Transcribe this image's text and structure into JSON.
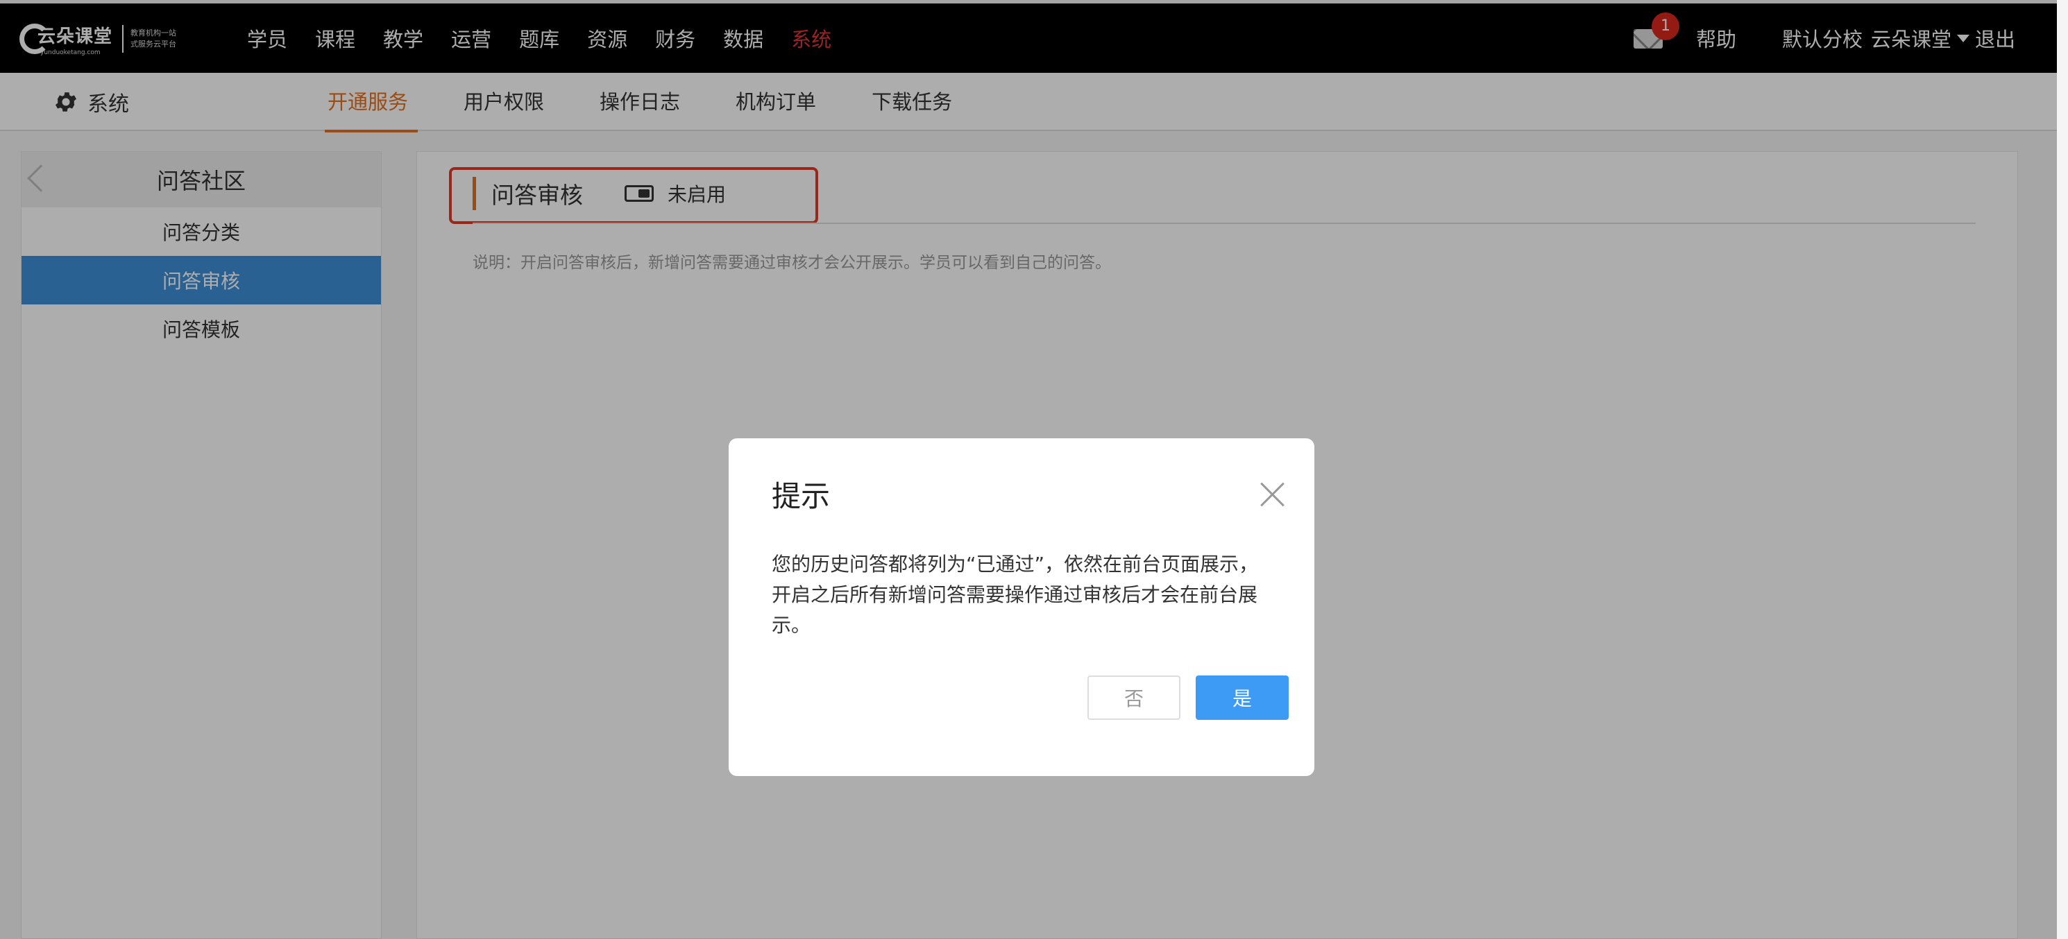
{
  "logo": {
    "name": "云朵课堂",
    "url": "yunduoketang.com",
    "slogan_line1": "教育机构一站",
    "slogan_line2": "式服务云平台"
  },
  "topnav": {
    "items": [
      "学员",
      "课程",
      "教学",
      "运营",
      "题库",
      "资源",
      "财务",
      "数据",
      "系统"
    ],
    "active": "系统"
  },
  "topright": {
    "mail_badge": "1",
    "help": "帮助",
    "school": "默认分校",
    "user": "云朵课堂",
    "logout": "退出"
  },
  "subbar": {
    "title": "系统",
    "tabs": [
      "开通服务",
      "用户权限",
      "操作日志",
      "机构订单",
      "下载任务"
    ],
    "active": "开通服务"
  },
  "sidebar": {
    "header": "问答社区",
    "items": [
      "问答分类",
      "问答审核",
      "问答模板"
    ],
    "active": "问答审核"
  },
  "main": {
    "section_title": "问答审核",
    "toggle_label": "未启用",
    "description": "说明：开启问答审核后，新增问答需要通过审核才会公开展示。学员可以看到自己的问答。"
  },
  "modal": {
    "title": "提示",
    "body_line1": "您的历史问答都将列为“已通过”，依然在前台页面展示，",
    "body_line2": "开启之后所有新增问答需要操作通过审核后才会在前台展",
    "body_line3": "示。",
    "cancel": "否",
    "confirm": "是"
  },
  "colors": {
    "accent_orange": "#e2701f",
    "nav_active_red": "#e73333",
    "sidebar_active_blue": "#3d8fd7",
    "confirm_blue": "#3e9bf5",
    "highlight_red": "#e23b2a"
  }
}
